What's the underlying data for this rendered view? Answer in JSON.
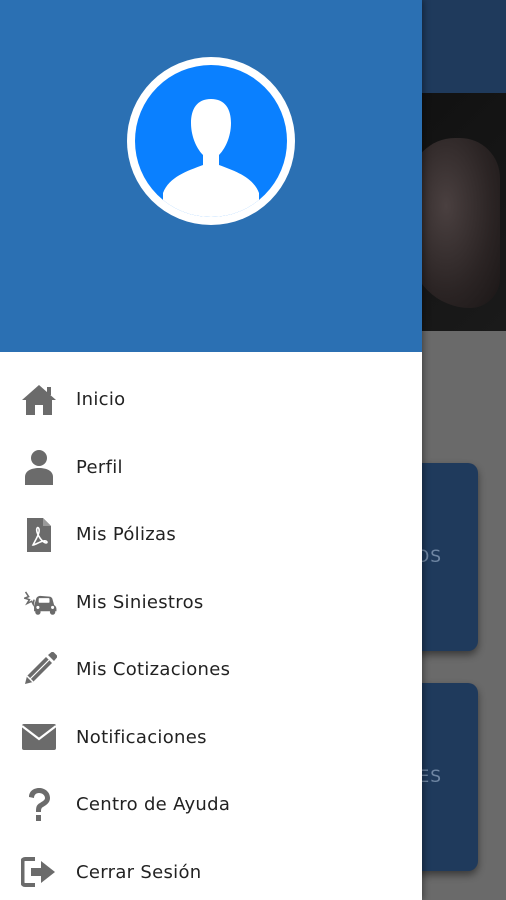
{
  "drawer": {
    "header_color": "#2b70b3",
    "avatar_color": "#0a80ff",
    "menu": [
      {
        "label": "Inicio",
        "icon": "home-icon"
      },
      {
        "label": "Perfil",
        "icon": "person-icon"
      },
      {
        "label": "Mis Pólizas",
        "icon": "pdf-file-icon"
      },
      {
        "label": "Mis Siniestros",
        "icon": "car-crash-icon"
      },
      {
        "label": "Mis Cotizaciones",
        "icon": "pencil-icon"
      },
      {
        "label": "Notificaciones",
        "icon": "envelope-icon"
      },
      {
        "label": "Centro de Ayuda",
        "icon": "question-mark-icon"
      },
      {
        "label": "Cerrar Sesión",
        "icon": "sign-out-icon"
      }
    ],
    "icon_color": "#6b6b6b"
  },
  "background": {
    "appbar_color": "#1f3a5c",
    "cards": [
      {
        "label_fragment": "OS"
      },
      {
        "label_fragment": "NES"
      }
    ]
  }
}
